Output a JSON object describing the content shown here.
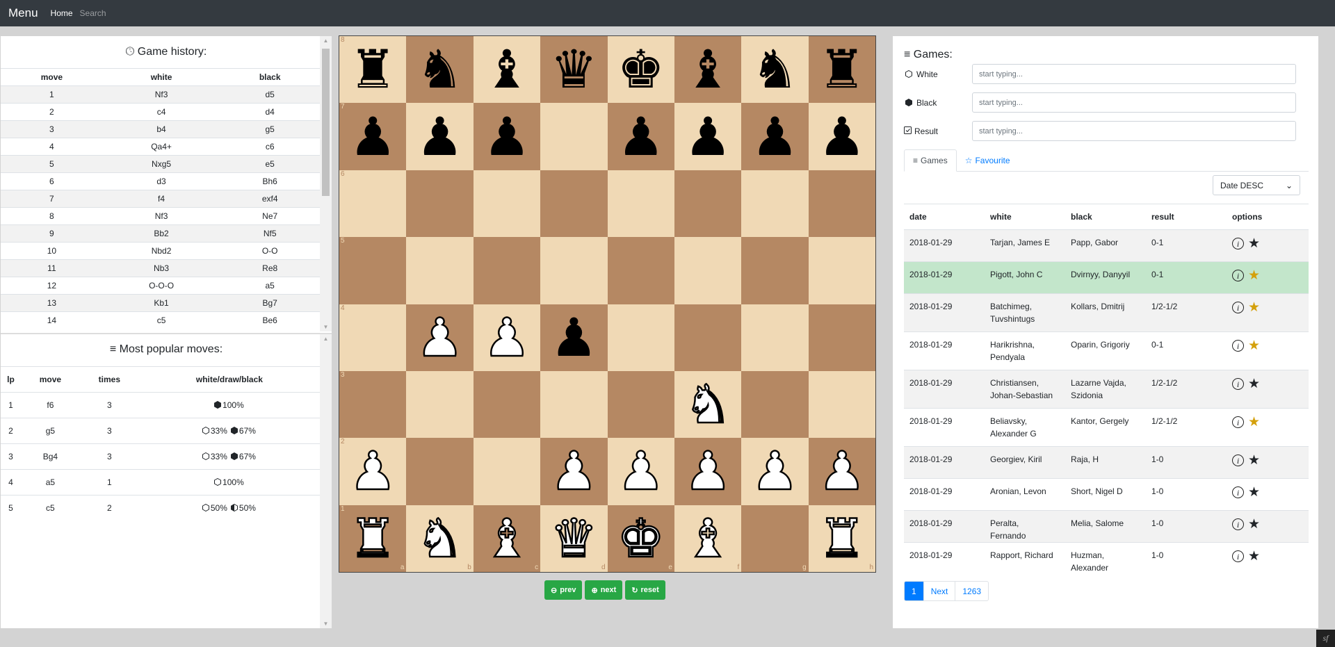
{
  "nav": {
    "brand": "Menu",
    "home": "Home",
    "search": "Search"
  },
  "history": {
    "title": "Game history:",
    "icon": "clock-icon",
    "headers": [
      "move",
      "white",
      "black"
    ],
    "rows": [
      [
        "1",
        "Nf3",
        "d5"
      ],
      [
        "2",
        "c4",
        "d4"
      ],
      [
        "3",
        "b4",
        "g5"
      ],
      [
        "4",
        "Qa4+",
        "c6"
      ],
      [
        "5",
        "Nxg5",
        "e5"
      ],
      [
        "6",
        "d3",
        "Bh6"
      ],
      [
        "7",
        "f4",
        "exf4"
      ],
      [
        "8",
        "Nf3",
        "Ne7"
      ],
      [
        "9",
        "Bb2",
        "Nf5"
      ],
      [
        "10",
        "Nbd2",
        "O-O"
      ],
      [
        "11",
        "Nb3",
        "Re8"
      ],
      [
        "12",
        "O-O-O",
        "a5"
      ],
      [
        "13",
        "Kb1",
        "Bg7"
      ],
      [
        "14",
        "c5",
        "Be6"
      ]
    ],
    "highlighted": {
      "row": 2,
      "col": "white"
    }
  },
  "popular": {
    "title": "Most popular moves:",
    "icon": "list-icon",
    "headers": [
      "lp",
      "move",
      "times",
      "white/draw/black"
    ],
    "rows": [
      {
        "lp": "1",
        "move": "f6",
        "times": "3",
        "stats": [
          {
            "side": "black",
            "pct": "100%"
          }
        ]
      },
      {
        "lp": "2",
        "move": "g5",
        "times": "3",
        "stats": [
          {
            "side": "white",
            "pct": "33%"
          },
          {
            "side": "black",
            "pct": "67%"
          }
        ]
      },
      {
        "lp": "3",
        "move": "Bg4",
        "times": "3",
        "stats": [
          {
            "side": "white",
            "pct": "33%"
          },
          {
            "side": "black",
            "pct": "67%"
          }
        ]
      },
      {
        "lp": "4",
        "move": "a5",
        "times": "1",
        "stats": [
          {
            "side": "white",
            "pct": "100%"
          }
        ]
      },
      {
        "lp": "5",
        "move": "c5",
        "times": "2",
        "stats": [
          {
            "side": "white",
            "pct": "50%"
          },
          {
            "side": "draw",
            "pct": "50%"
          }
        ]
      }
    ]
  },
  "board": {
    "colors": {
      "light": "#f0d9b5",
      "dark": "#b58863"
    },
    "ranks": [
      "8",
      "7",
      "6",
      "5",
      "4",
      "3",
      "2",
      "1"
    ],
    "files": [
      "a",
      "b",
      "c",
      "d",
      "e",
      "f",
      "g",
      "h"
    ],
    "position": [
      "rnbqkbnr",
      "ppp.pppp",
      "........",
      "........",
      ".PPp....",
      ".....N..",
      "P..PPPPP",
      "RNBQKB.R"
    ]
  },
  "controls": {
    "prev": "prev",
    "next": "next",
    "reset": "reset"
  },
  "games": {
    "title": "Games:",
    "filters": [
      {
        "label": "White",
        "icon": "white-hexagon-icon",
        "placeholder": "start typing..."
      },
      {
        "label": "Black",
        "icon": "black-hexagon-icon",
        "placeholder": "start typing..."
      },
      {
        "label": "Result",
        "icon": "checkbox-icon",
        "placeholder": "start typing..."
      }
    ],
    "tabs": [
      {
        "label": "Games",
        "icon": "list-icon"
      },
      {
        "label": "Favourite",
        "icon": "star-outline-icon"
      }
    ],
    "sort": "Date DESC",
    "headers": [
      "date",
      "white",
      "black",
      "result",
      "options"
    ],
    "rows": [
      {
        "date": "2018-01-29",
        "white": "Tarjan, James E",
        "black": "Papp, Gabor",
        "result": "0-1",
        "fav": false
      },
      {
        "date": "2018-01-29",
        "white": "Pigott, John C",
        "black": "Dvirnyy, Danyyil",
        "result": "0-1",
        "fav": true,
        "selected": true
      },
      {
        "date": "2018-01-29",
        "white": "Batchimeg, Tuvshintugs",
        "black": "Kollars, Dmitrij",
        "result": "1/2-1/2",
        "fav": true
      },
      {
        "date": "2018-01-29",
        "white": "Harikrishna, Pendyala",
        "black": "Oparin, Grigoriy",
        "result": "0-1",
        "fav": true
      },
      {
        "date": "2018-01-29",
        "white": "Christiansen, Johan-Sebastian",
        "black": "Lazarne Vajda, Szidonia",
        "result": "1/2-1/2",
        "fav": false
      },
      {
        "date": "2018-01-29",
        "white": "Beliavsky, Alexander G",
        "black": "Kantor, Gergely",
        "result": "1/2-1/2",
        "fav": true
      },
      {
        "date": "2018-01-29",
        "white": "Georgiev, Kiril",
        "black": "Raja, H",
        "result": "1-0",
        "fav": false
      },
      {
        "date": "2018-01-29",
        "white": "Aronian, Levon",
        "black": "Short, Nigel D",
        "result": "1-0",
        "fav": false
      },
      {
        "date": "2018-01-29",
        "white": "Peralta, Fernando",
        "black": "Melia, Salome",
        "result": "1-0",
        "fav": false
      },
      {
        "date": "2018-01-29",
        "white": "Rapport, Richard",
        "black": "Huzman, Alexander",
        "result": "1-0",
        "fav": false
      }
    ],
    "favColor": "#d4a00b",
    "starColor": "#212529",
    "selectedColor": "#c3e6cb",
    "pagination": {
      "current": "1",
      "next": "Next",
      "last": "1263"
    }
  }
}
